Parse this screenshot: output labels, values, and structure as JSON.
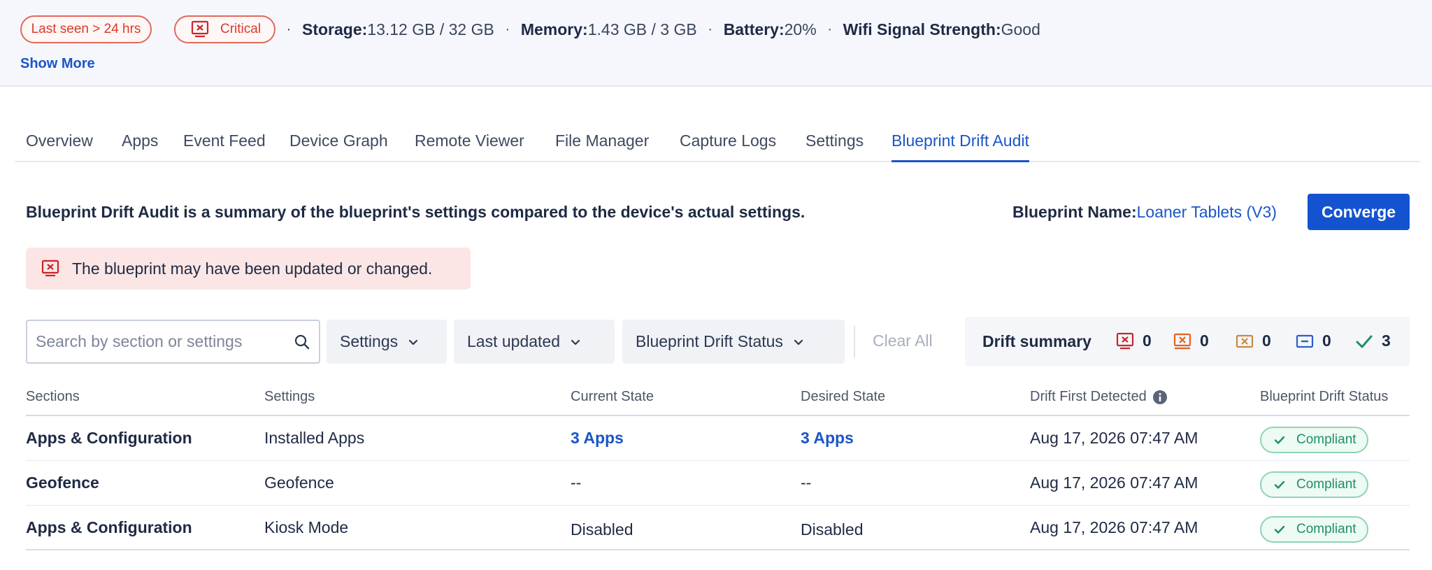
{
  "status": {
    "last_seen": "Last seen > 24 hrs",
    "critical": "Critical",
    "separator": "·",
    "storage_label": "Storage:",
    "storage_value": "13.12 GB / 32 GB",
    "memory_label": "Memory:",
    "memory_value": "1.43 GB / 3 GB",
    "battery_label": "Battery:",
    "battery_value": "20%",
    "wifi_label": "Wifi Signal Strength:",
    "wifi_value": "Good",
    "show_more": "Show More"
  },
  "tabs": [
    {
      "label": "Overview",
      "active": false
    },
    {
      "label": "Apps",
      "active": false
    },
    {
      "label": "Event Feed",
      "active": false
    },
    {
      "label": "Device Graph",
      "active": false
    },
    {
      "label": "Remote Viewer",
      "active": false
    },
    {
      "label": "File Manager",
      "active": false
    },
    {
      "label": "Capture Logs",
      "active": false
    },
    {
      "label": "Settings",
      "active": false
    },
    {
      "label": "Blueprint Drift Audit",
      "active": true
    }
  ],
  "audit": {
    "description": "Blueprint Drift Audit is a summary of the blueprint's settings compared to the device's actual settings.",
    "blueprint_label": "Blueprint Name:",
    "blueprint_name": "Loaner Tablets (V3)",
    "converge_button": "Converge",
    "alert": "The blueprint may have been updated or changed."
  },
  "filters": {
    "search_placeholder": "Search by section or settings",
    "search_value": "",
    "settings_dropdown": "Settings",
    "last_updated_dropdown": "Last updated",
    "drift_status_dropdown": "Blueprint Drift Status",
    "clear_all": "Clear All"
  },
  "drift_summary": {
    "label": "Drift summary",
    "counts": [
      {
        "icon": "critical-drift-icon",
        "color": "#c8262b",
        "count": "0"
      },
      {
        "icon": "high-drift-icon",
        "color": "#e0621f",
        "count": "0"
      },
      {
        "icon": "medium-drift-icon",
        "color": "#c98a3d",
        "count": "0"
      },
      {
        "icon": "low-drift-icon",
        "color": "#2c5fc9",
        "count": "0"
      },
      {
        "icon": "compliant-check-icon",
        "color": "#1f9060",
        "count": "3"
      }
    ]
  },
  "table": {
    "headers": {
      "sections": "Sections",
      "settings": "Settings",
      "current_state": "Current State",
      "desired_state": "Desired State",
      "drift_first_detected": "Drift First Detected",
      "drift_status": "Blueprint Drift Status"
    },
    "rows": [
      {
        "section": "Apps & Configuration",
        "setting": "Installed Apps",
        "current": "3 Apps",
        "desired": "3 Apps",
        "detected": "Aug 17, 2026 07:47 AM",
        "status": "Compliant"
      },
      {
        "section": "Geofence",
        "setting": "Geofence",
        "current": "--",
        "desired": "--",
        "detected": "Aug 17, 2026 07:47 AM",
        "status": "Compliant"
      },
      {
        "section": "Apps & Configuration",
        "setting": "Kiosk Mode",
        "current": "Disabled",
        "desired": "Disabled",
        "detected": "Aug 17, 2026 07:47 AM",
        "status": "Compliant"
      }
    ]
  },
  "colors": {
    "accent": "#1453cf",
    "critical": "#d93a2b",
    "compliant": "#1f9060",
    "alert_bg": "#fbe6e5"
  }
}
